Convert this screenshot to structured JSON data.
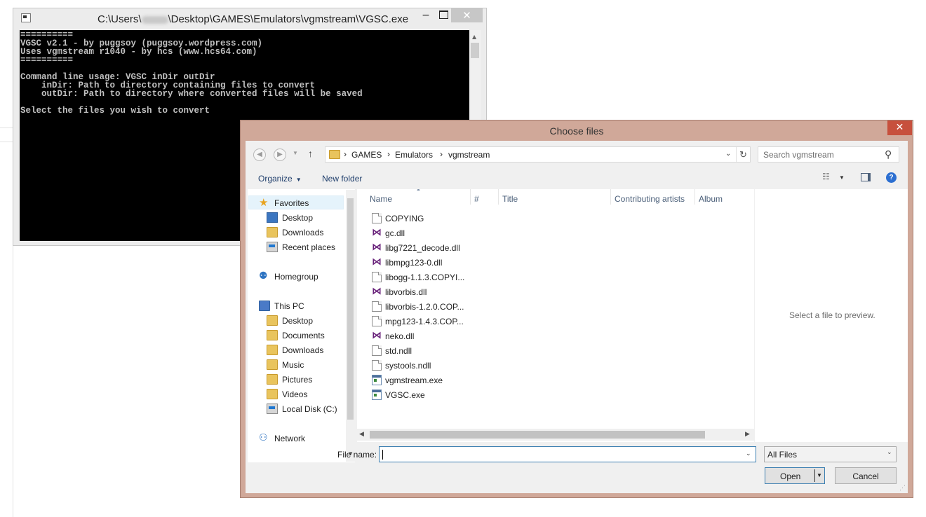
{
  "console": {
    "title_prefix": "C:\\Users\\",
    "title_suffix": "\\Desktop\\GAMES\\Emulators\\vgmstream\\VGSC.exe",
    "minimize": "−",
    "close": "✕",
    "output": "==========\nVGSC v2.1 - by puggsoy (puggsoy.wordpress.com)\nUses vgmstream r1040 - by hcs (www.hcs64.com)\n==========\n\nCommand line usage: VGSC inDir outDir\n    inDir: Path to directory containing files to convert\n    outDir: Path to directory where converted files will be saved\n\nSelect the files you wish to convert"
  },
  "dialog": {
    "title": "Choose files",
    "close": "✕",
    "breadcrumb": [
      "GAMES",
      "Emulators",
      "vgmstream"
    ],
    "breadcrumb_sep": "›",
    "search_placeholder": "Search vgmstream",
    "toolbar": {
      "organize": "Organize",
      "new_folder": "New folder"
    },
    "nav": {
      "favorites": "Favorites",
      "desktop": "Desktop",
      "downloads": "Downloads",
      "recent_places": "Recent places",
      "homegroup": "Homegroup",
      "this_pc": "This PC",
      "pc_desktop": "Desktop",
      "documents": "Documents",
      "pc_downloads": "Downloads",
      "music": "Music",
      "pictures": "Pictures",
      "videos": "Videos",
      "local_disk": "Local Disk (C:)",
      "network": "Network"
    },
    "columns": {
      "name": "Name",
      "number": "#",
      "title": "Title",
      "contributing_artists": "Contributing artists",
      "album": "Album"
    },
    "files": [
      {
        "name": "COPYING",
        "icon": "document-icon"
      },
      {
        "name": "gc.dll",
        "icon": "visual-studio-icon"
      },
      {
        "name": "libg7221_decode.dll",
        "icon": "visual-studio-icon"
      },
      {
        "name": "libmpg123-0.dll",
        "icon": "visual-studio-icon"
      },
      {
        "name": "libogg-1.1.3.COPYI...",
        "icon": "document-icon"
      },
      {
        "name": "libvorbis.dll",
        "icon": "visual-studio-icon"
      },
      {
        "name": "libvorbis-1.2.0.COP...",
        "icon": "document-icon"
      },
      {
        "name": "mpg123-1.4.3.COP...",
        "icon": "document-icon"
      },
      {
        "name": "neko.dll",
        "icon": "visual-studio-icon"
      },
      {
        "name": "std.ndll",
        "icon": "document-icon"
      },
      {
        "name": "systools.ndll",
        "icon": "document-icon"
      },
      {
        "name": "vgmstream.exe",
        "icon": "application-icon"
      },
      {
        "name": "VGSC.exe",
        "icon": "application-icon"
      }
    ],
    "preview_text": "Select a file to preview.",
    "file_name_label": "File name:",
    "file_name_value": "",
    "filter_value": "All Files",
    "open_label": "Open",
    "cancel_label": "Cancel"
  }
}
